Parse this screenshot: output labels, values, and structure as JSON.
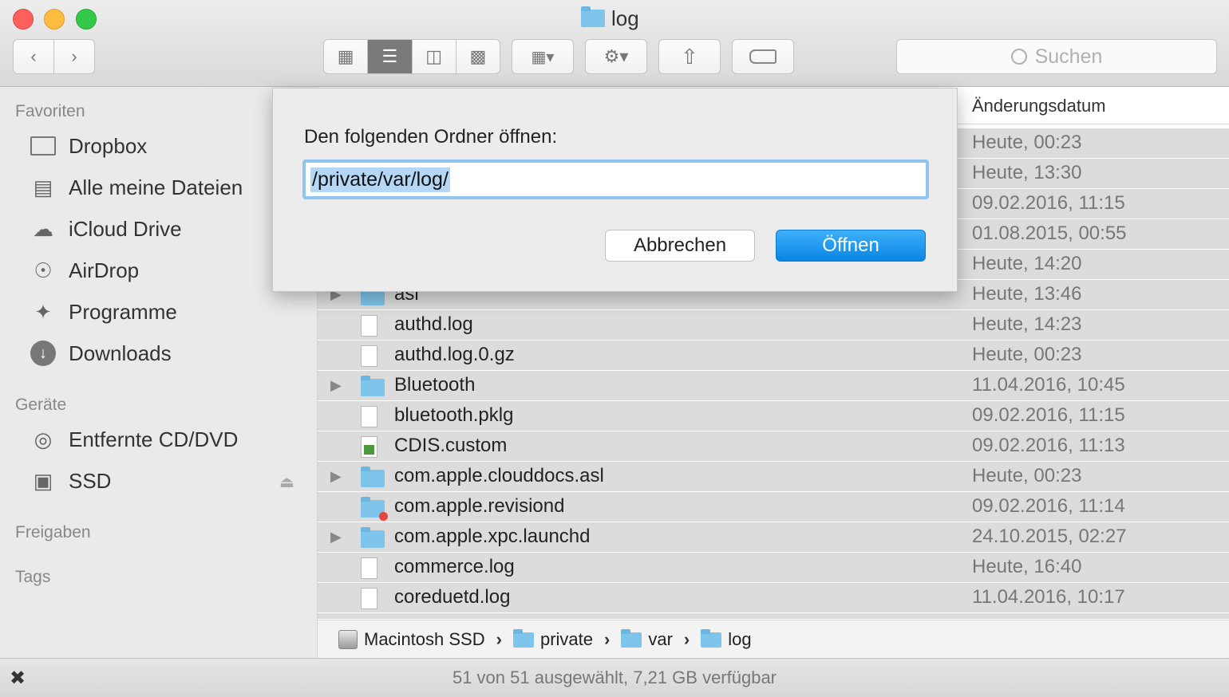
{
  "window": {
    "title": "log"
  },
  "toolbar": {
    "search_placeholder": "Suchen"
  },
  "sidebar": {
    "favorites_heading": "Favoriten",
    "favorites": [
      {
        "label": "Dropbox",
        "icon": "folder-icon"
      },
      {
        "label": "Alle meine Dateien",
        "icon": "all-files-icon"
      },
      {
        "label": "iCloud Drive",
        "icon": "cloud-icon"
      },
      {
        "label": "AirDrop",
        "icon": "airdrop-icon"
      },
      {
        "label": "Programme",
        "icon": "applications-icon"
      },
      {
        "label": "Downloads",
        "icon": "download-icon"
      }
    ],
    "devices_heading": "Geräte",
    "devices": [
      {
        "label": "Entfernte CD/DVD",
        "icon": "disc-icon"
      },
      {
        "label": "SSD",
        "icon": "drive-icon"
      }
    ],
    "shared_heading": "Freigaben",
    "tags_heading": "Tags"
  },
  "list": {
    "date_column": "Änderungsdatum",
    "rows": [
      {
        "name": "",
        "date": "Heute, 00:23"
      },
      {
        "name": "",
        "date": "Heute, 13:30"
      },
      {
        "name": "",
        "date": "09.02.2016, 11:15"
      },
      {
        "name": "",
        "date": "01.08.2015, 00:55"
      },
      {
        "name": "",
        "date": "Heute, 14:20"
      },
      {
        "name": "asl",
        "date": "Heute, 13:46"
      },
      {
        "name": "authd.log",
        "date": "Heute, 14:23"
      },
      {
        "name": "authd.log.0.gz",
        "date": "Heute, 00:23"
      },
      {
        "name": "Bluetooth",
        "date": "11.04.2016, 10:45"
      },
      {
        "name": "bluetooth.pklg",
        "date": "09.02.2016, 11:15"
      },
      {
        "name": "CDIS.custom",
        "date": "09.02.2016, 11:13"
      },
      {
        "name": "com.apple.clouddocs.asl",
        "date": "Heute, 00:23"
      },
      {
        "name": "com.apple.revisiond",
        "date": "09.02.2016, 11:14"
      },
      {
        "name": "com.apple.xpc.launchd",
        "date": "24.10.2015, 02:27"
      },
      {
        "name": "commerce.log",
        "date": "Heute, 16:40"
      },
      {
        "name": "coreduetd.log",
        "date": "11.04.2016, 10:17"
      }
    ]
  },
  "pathbar": {
    "items": [
      "Macintosh SSD",
      "private",
      "var",
      "log"
    ]
  },
  "status": {
    "text": "51 von 51 ausgewählt, 7,21 GB verfügbar"
  },
  "dialog": {
    "label": "Den folgenden Ordner öffnen:",
    "value": "/private/var/log/",
    "cancel_label": "Abbrechen",
    "open_label": "Öffnen"
  }
}
